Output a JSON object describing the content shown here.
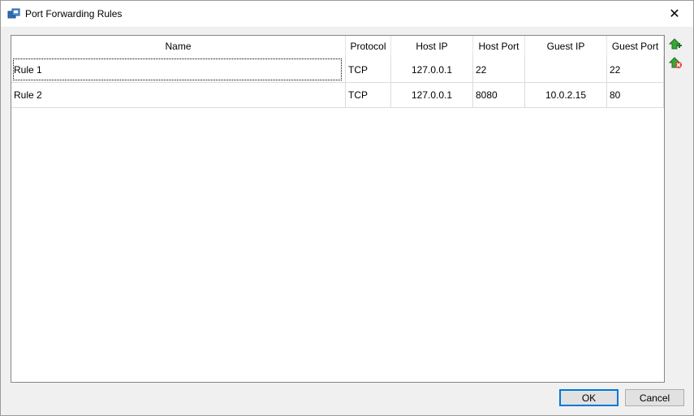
{
  "window": {
    "title": "Port Forwarding Rules"
  },
  "titlebar": {
    "close_glyph": "✕"
  },
  "table": {
    "headers": {
      "name": "Name",
      "protocol": "Protocol",
      "host_ip": "Host IP",
      "host_port": "Host Port",
      "guest_ip": "Guest IP",
      "guest_port": "Guest Port"
    },
    "rows": [
      {
        "name": "Rule 1",
        "protocol": "TCP",
        "host_ip": "127.0.0.1",
        "host_port": "22",
        "guest_ip": "",
        "guest_port": "22"
      },
      {
        "name": "Rule 2",
        "protocol": "TCP",
        "host_ip": "127.0.0.1",
        "host_port": "8080",
        "guest_ip": "10.0.2.15",
        "guest_port": "80"
      }
    ]
  },
  "side_buttons": {
    "add_icon": "add-rule-icon",
    "remove_icon": "remove-rule-icon"
  },
  "buttons": {
    "ok": "OK",
    "cancel": "Cancel"
  },
  "colors": {
    "accent": "#0078d7",
    "add_green": "#3aa63a",
    "remove_red": "#d9443a"
  }
}
